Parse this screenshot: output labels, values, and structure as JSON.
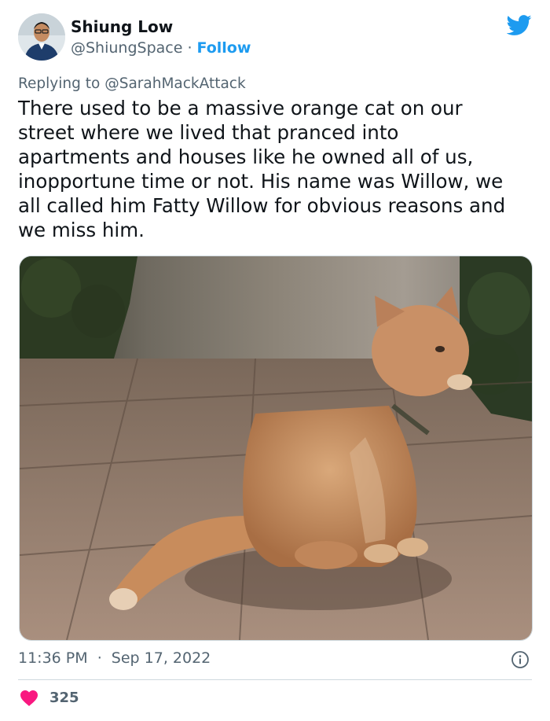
{
  "author": {
    "name": "Shiung Low",
    "handle": "@ShiungSpace",
    "separator": "·",
    "follow_label": "Follow"
  },
  "reply": {
    "prefix": "Replying to",
    "to_handle": "@SarahMackAttack"
  },
  "tweet": {
    "lines": [
      "There used to be a massive orange cat on our",
      "street where we lived that pranced into",
      "apartments and houses like he owned all of us,",
      "inopportune time or not. His name was Willow, we",
      "all called him Fatty Willow for obvious reasons and",
      "we miss him."
    ]
  },
  "meta": {
    "time": "11:36 PM",
    "separator": "·",
    "date": "Sep 17, 2022"
  },
  "engagement": {
    "likes": "325"
  },
  "icons": {
    "platform": "bird-icon",
    "info": "info-icon",
    "like": "heart-icon"
  },
  "colors": {
    "accent": "#1d9bf0",
    "like": "#f91880",
    "secondary_text": "#536471"
  }
}
